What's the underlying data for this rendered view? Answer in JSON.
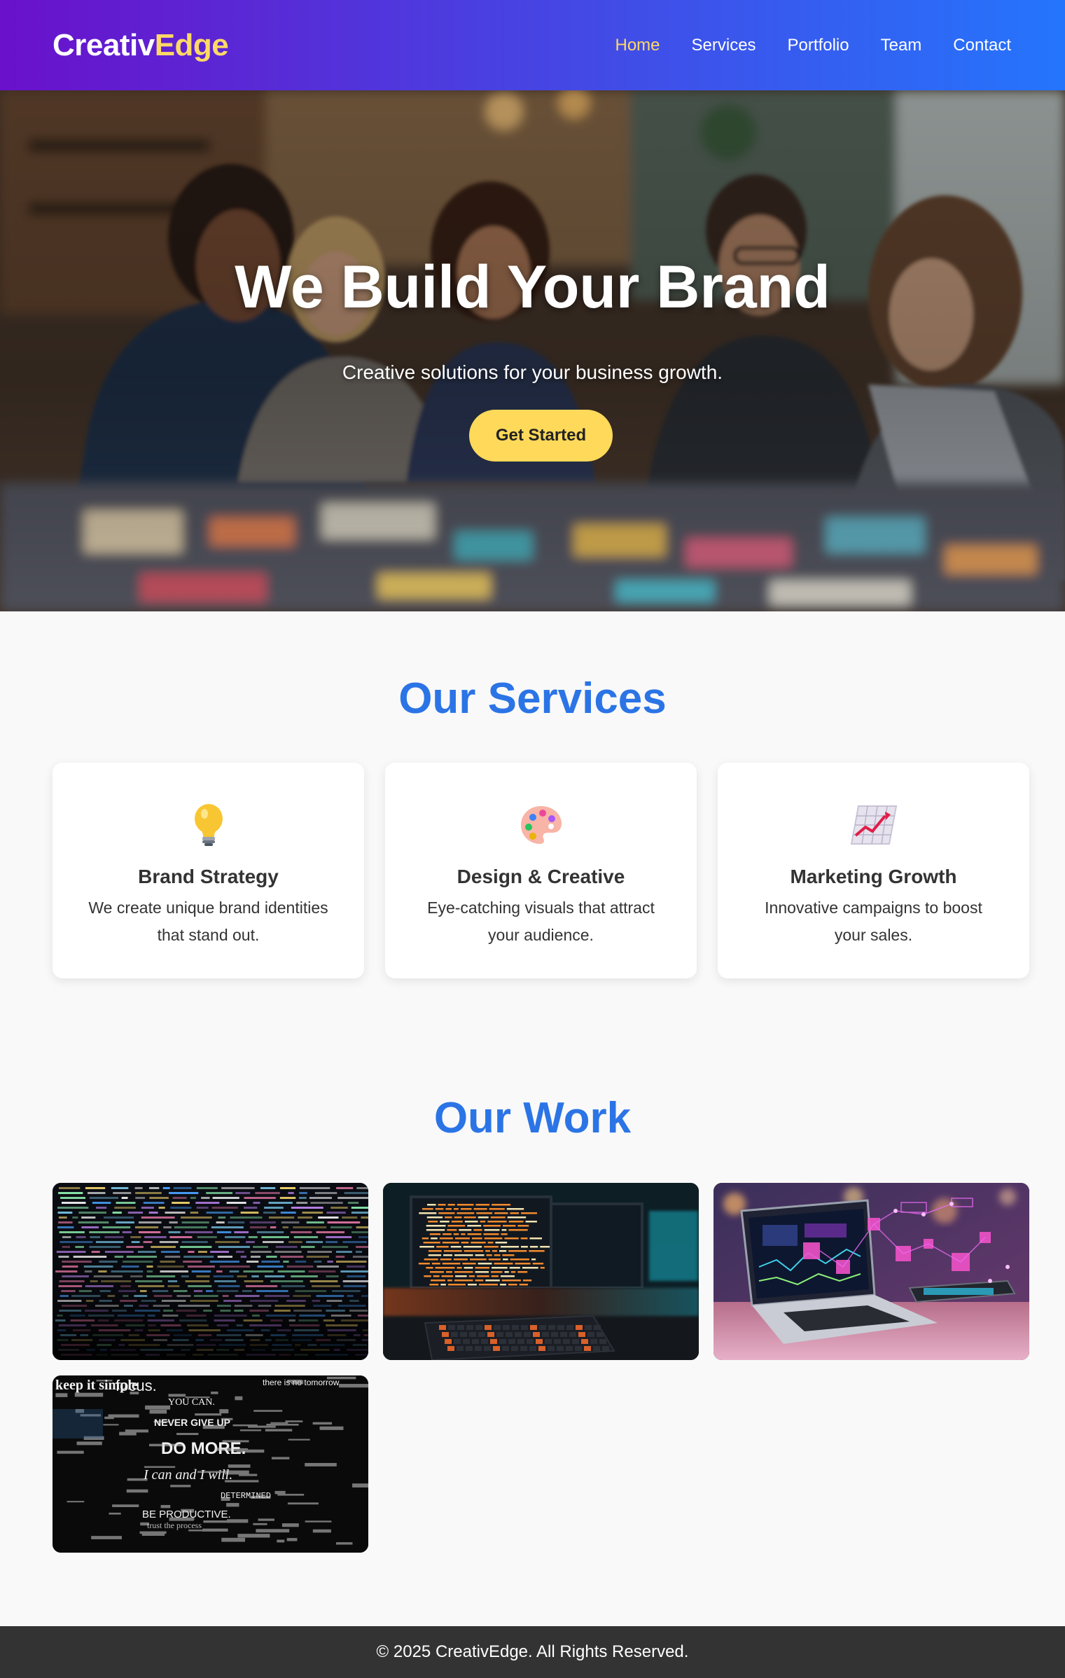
{
  "brand": {
    "name_main": "Creativ",
    "name_accent": "Edge"
  },
  "nav": {
    "items": [
      {
        "label": "Home",
        "active": true
      },
      {
        "label": "Services",
        "active": false
      },
      {
        "label": "Portfolio",
        "active": false
      },
      {
        "label": "Team",
        "active": false
      },
      {
        "label": "Contact",
        "active": false
      }
    ]
  },
  "hero": {
    "title": "We Build Your Brand",
    "subtitle": "Creative solutions for your business growth.",
    "cta_label": "Get Started"
  },
  "services": {
    "title": "Our Services",
    "items": [
      {
        "icon": "lightbulb-icon",
        "title": "Brand Strategy",
        "description": "We create unique brand identities that stand out."
      },
      {
        "icon": "palette-icon",
        "title": "Design & Creative",
        "description": "Eye-catching visuals that attract your audience."
      },
      {
        "icon": "chart-increasing-icon",
        "title": "Marketing Growth",
        "description": "Innovative campaigns to boost your sales."
      }
    ]
  },
  "work": {
    "title": "Our Work",
    "items": [
      {
        "image": "code-on-dark-screen-image"
      },
      {
        "image": "programming-workstation-image"
      },
      {
        "image": "laptop-with-holographic-data-image"
      },
      {
        "image": "motivational-typography-collage-image"
      }
    ]
  },
  "collage_words": [
    "keep it simple",
    "focus.",
    "there is no tomorrow",
    "YOU CAN.",
    "NEVER GIVE UP",
    "DO MORE.",
    "I can and I will.",
    "DETERMINED",
    "BE PRODUCTIVE.",
    "trust the process"
  ],
  "colors": {
    "header_start": "#6a11cb",
    "header_end": "#2575fc",
    "accent": "#ffd966",
    "heading_blue": "#2b74e6",
    "footer": "#333333"
  },
  "footer": {
    "text": "© 2025 CreativEdge. All Rights Reserved."
  }
}
